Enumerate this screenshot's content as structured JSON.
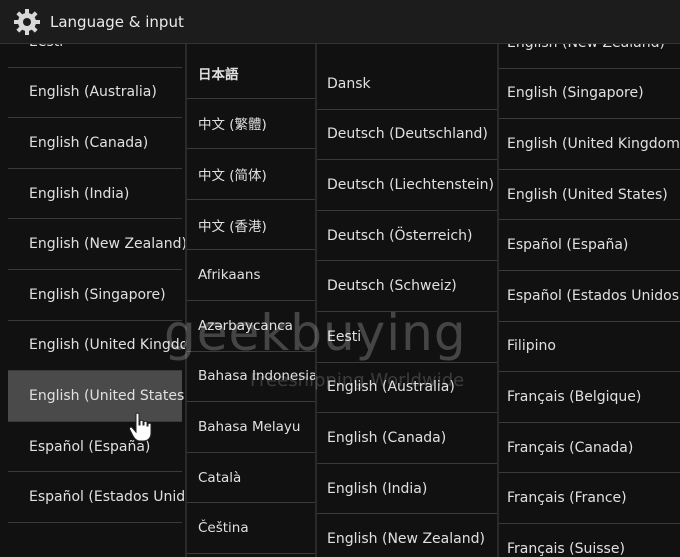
{
  "header": {
    "title": "Language & input",
    "icon": "gear-icon"
  },
  "columns": [
    {
      "items": [
        {
          "label": "Eesti"
        },
        {
          "label": "English (Australia)"
        },
        {
          "label": "English (Canada)"
        },
        {
          "label": "English (India)"
        },
        {
          "label": "English (New Zealand)"
        },
        {
          "label": "English (Singapore)"
        },
        {
          "label": "English (United Kingdom)"
        },
        {
          "label": "English (United States)",
          "selected": true
        },
        {
          "label": "Español (España)"
        },
        {
          "label": "Español (Estados Unidos)"
        }
      ]
    },
    {
      "items": [
        {
          "label": "日本語"
        },
        {
          "label": "中文 (繁體)"
        },
        {
          "label": "中文 (简体)"
        },
        {
          "label": "中文 (香港)"
        },
        {
          "label": "Afrikaans"
        },
        {
          "label": "Azərbaycanca"
        },
        {
          "label": "Bahasa Indonesia"
        },
        {
          "label": "Bahasa Melayu"
        },
        {
          "label": "Català"
        },
        {
          "label": "Čeština"
        }
      ]
    },
    {
      "items": [
        {
          "label": "Dansk"
        },
        {
          "label": "Deutsch (Deutschland)"
        },
        {
          "label": "Deutsch (Liechtenstein)"
        },
        {
          "label": "Deutsch (Österreich)"
        },
        {
          "label": "Deutsch (Schweiz)"
        },
        {
          "label": "Eesti"
        },
        {
          "label": "English (Australia)"
        },
        {
          "label": "English (Canada)"
        },
        {
          "label": "English (India)"
        },
        {
          "label": "English (New Zealand)"
        }
      ]
    },
    {
      "items": [
        {
          "label": "English (New Zealand)"
        },
        {
          "label": "English (Singapore)"
        },
        {
          "label": "English (United Kingdom)"
        },
        {
          "label": "English (United States)"
        },
        {
          "label": "Español (España)"
        },
        {
          "label": "Español (Estados Unidos)"
        },
        {
          "label": "Filipino"
        },
        {
          "label": "Français (Belgique)"
        },
        {
          "label": "Français (Canada)"
        },
        {
          "label": "Français (France)"
        },
        {
          "label": "Français (Suisse)"
        }
      ]
    }
  ],
  "watermark": {
    "brand": "geekbuying",
    "tagline": "Freeshipping Worldwide"
  },
  "colors": {
    "background": "#111111",
    "selected": "#4a4a4a",
    "divider": "#3a3a3a"
  }
}
